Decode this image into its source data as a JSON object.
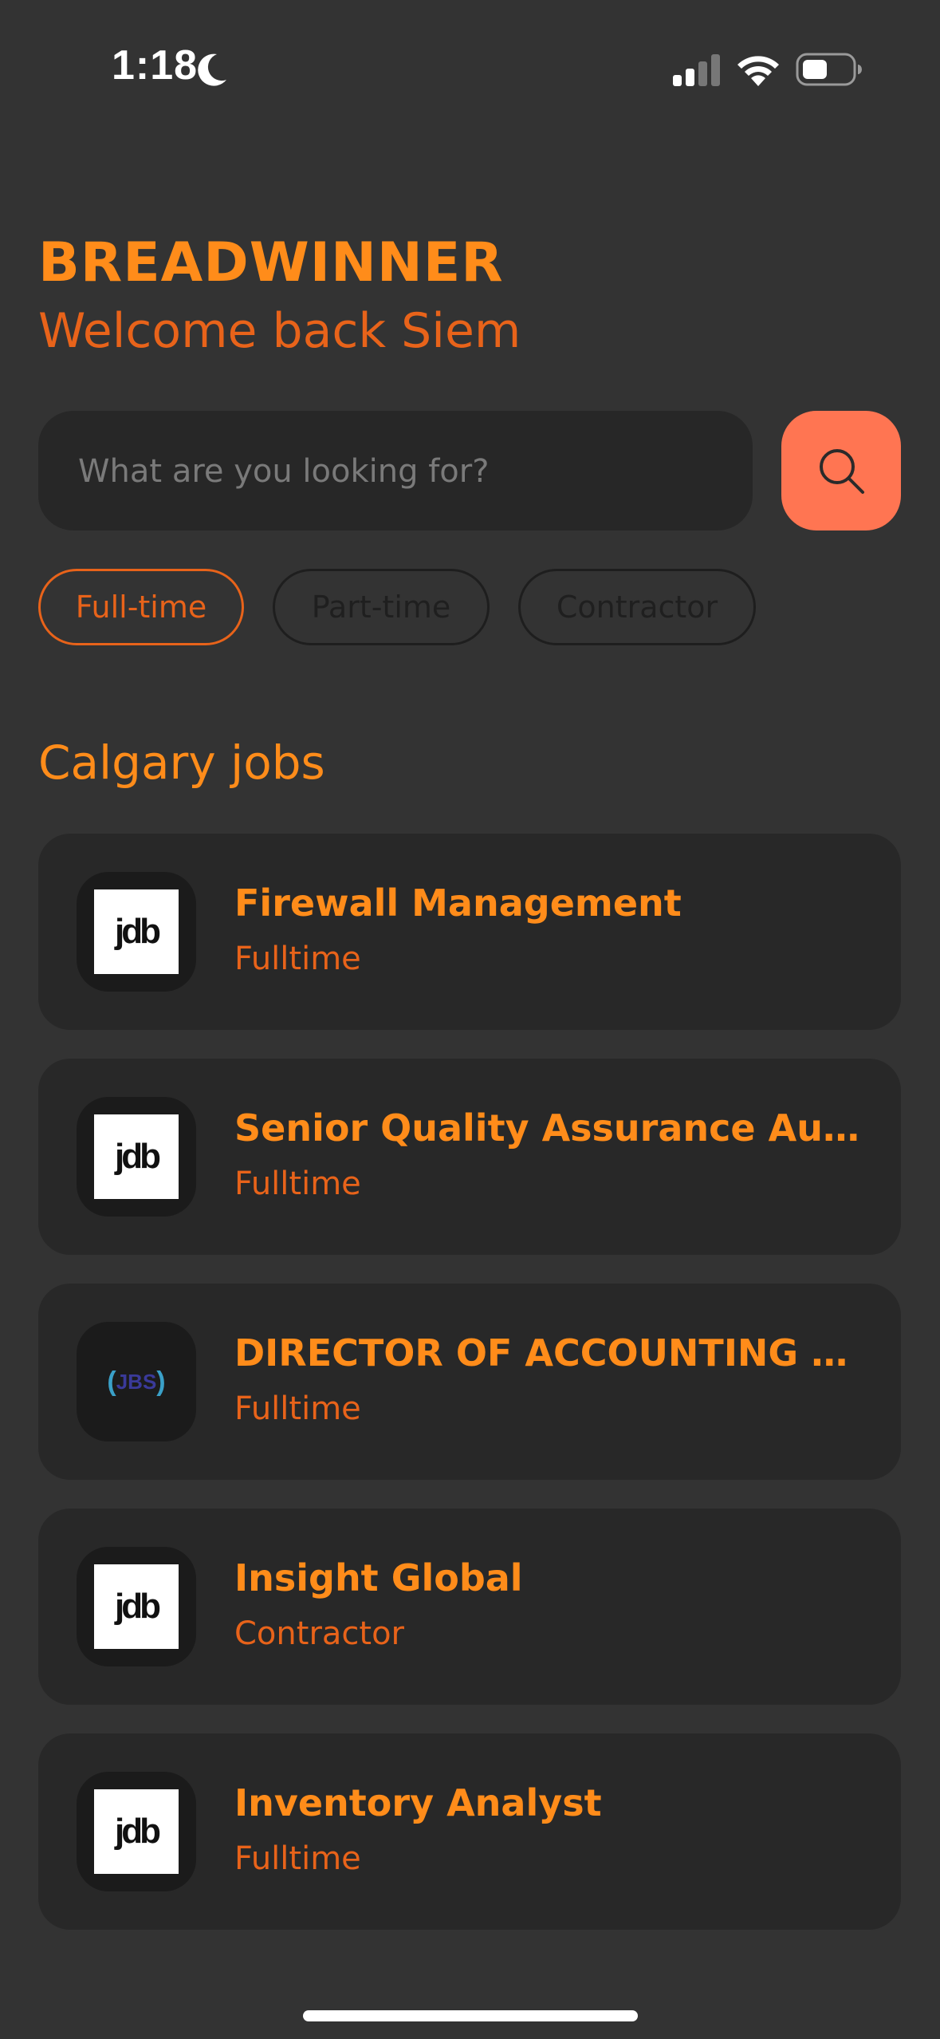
{
  "status_bar": {
    "time": "1:18",
    "icons": [
      "moon-icon",
      "cellular-signal-icon",
      "wifi-icon",
      "battery-icon"
    ]
  },
  "header": {
    "brand": "BREADWINNER",
    "welcome": "Welcome back Siem"
  },
  "search": {
    "placeholder": "What are you looking for?",
    "value": "",
    "button_icon": "search-icon"
  },
  "filters": [
    {
      "label": "Full-time",
      "selected": true
    },
    {
      "label": "Part-time",
      "selected": false
    },
    {
      "label": "Contractor",
      "selected": false
    }
  ],
  "section": {
    "title": "Calgary jobs"
  },
  "jobs": [
    {
      "title": "Firewall Management",
      "type": "Fulltime",
      "logo": "jdb"
    },
    {
      "title": "Senior Quality Assurance Auto...",
      "type": "Fulltime",
      "logo": "jdb"
    },
    {
      "title": "DIRECTOR OF ACCOUNTING A...",
      "type": "Fulltime",
      "logo": "JBS"
    },
    {
      "title": "Insight Global",
      "type": "Contractor",
      "logo": "jdb"
    },
    {
      "title": "Inventory Analyst",
      "type": "Fulltime",
      "logo": "jdb"
    }
  ],
  "colors": {
    "background": "#333333",
    "accent": "#ff8c1a",
    "accent_dark": "#e8631a",
    "search_button": "#ff7552",
    "card": "#282828"
  }
}
